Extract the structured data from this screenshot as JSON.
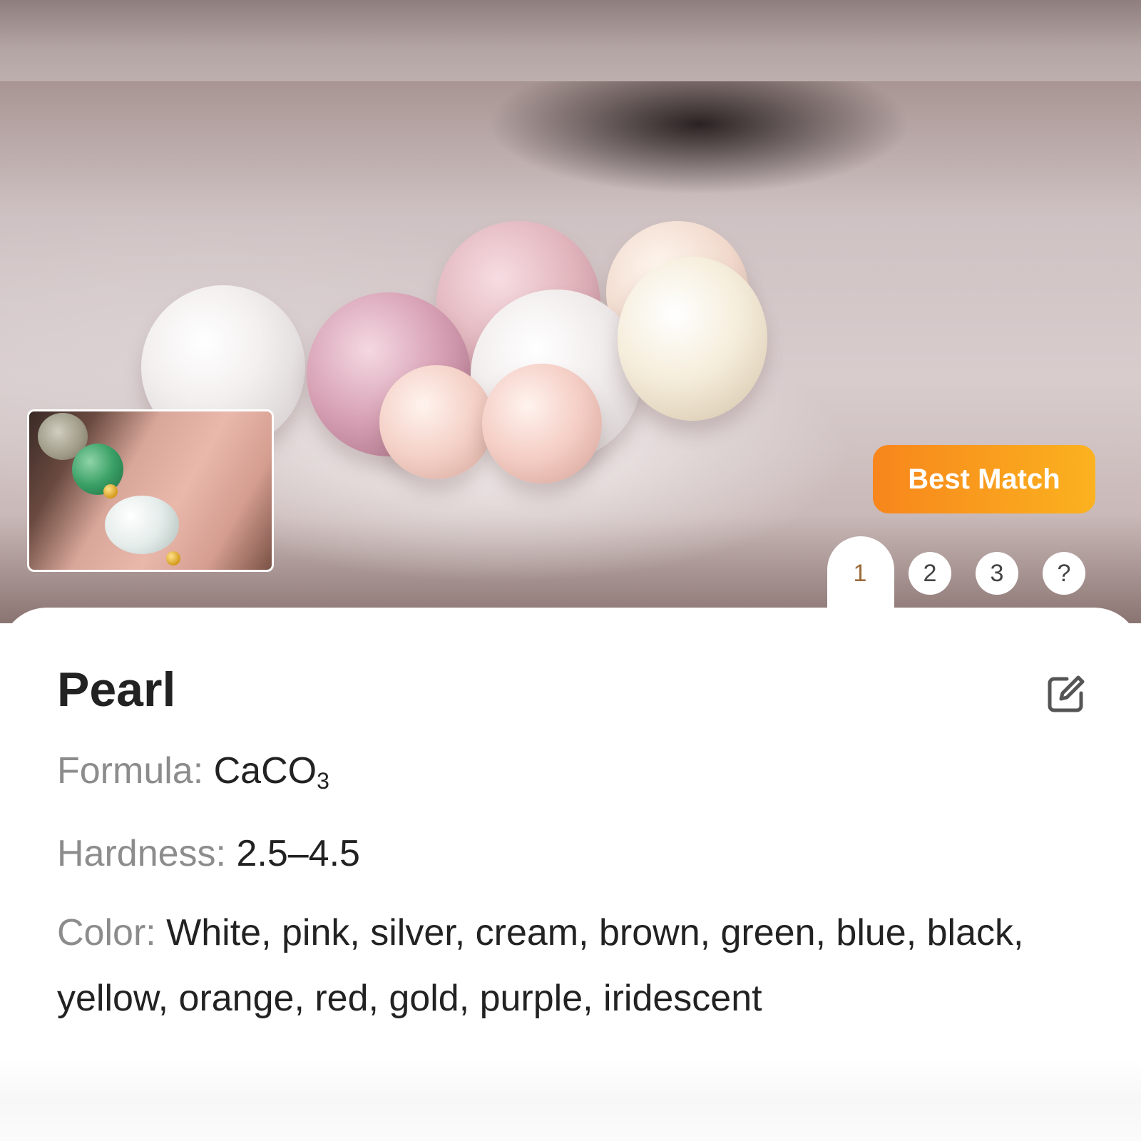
{
  "result": {
    "badge_label": "Best Match",
    "pages": [
      "1",
      "2",
      "3",
      "?"
    ],
    "active_page": "1",
    "name": "Pearl",
    "formula_label": "Formula:",
    "formula_main": "CaCO",
    "formula_subscript": "3",
    "hardness_label": "Hardness:",
    "hardness_value": "2.5–4.5",
    "color_label": "Color:",
    "color_value": "White, pink, silver, cream, brown, green, blue, black, yellow, orange, red, gold, purple, iridescent"
  },
  "icons": {
    "edit": "edit-icon"
  },
  "colors": {
    "badge_start": "#f7861c",
    "badge_end": "#fbb21f",
    "label_gray": "#8c8c8c",
    "text_dark": "#222222",
    "active_page": "#9c6b3a"
  }
}
